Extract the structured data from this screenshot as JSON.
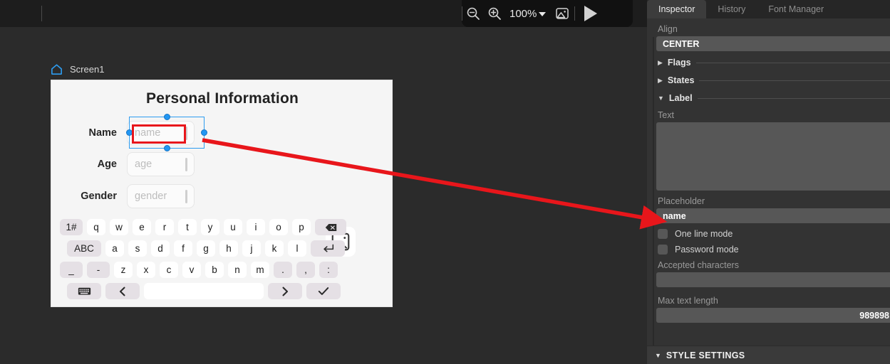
{
  "toolbar": {
    "zoom_out_icon": "zoom-out-icon",
    "zoom_in_icon": "zoom-in-icon",
    "zoom_level": "100%",
    "image_icon": "image-icon",
    "play_icon": "play-icon"
  },
  "canvas": {
    "screen_name": "Screen1",
    "home_icon": "home-icon",
    "form": {
      "title": "Personal Information",
      "fields": [
        {
          "label": "Name",
          "placeholder": "name",
          "selected": true
        },
        {
          "label": "Age",
          "placeholder": "age",
          "selected": false
        },
        {
          "label": "Gender",
          "placeholder": "gender",
          "selected": false
        }
      ],
      "image_placeholder_icon": "image-placeholder-icon"
    },
    "keyboard": {
      "row1": [
        "1#",
        "q",
        "w",
        "e",
        "r",
        "t",
        "y",
        "u",
        "i",
        "o",
        "p"
      ],
      "row1_action": "backspace",
      "row2": [
        "ABC",
        "a",
        "s",
        "d",
        "f",
        "g",
        "h",
        "j",
        "k",
        "l"
      ],
      "row2_action": "enter",
      "row3": [
        "_",
        "-",
        "z",
        "x",
        "c",
        "v",
        "b",
        "n",
        "m",
        ".",
        ",",
        ":"
      ],
      "row4": [
        "keyboard",
        "prev",
        "space",
        "next",
        "confirm"
      ]
    }
  },
  "inspector": {
    "tabs": [
      {
        "label": "Inspector",
        "active": true
      },
      {
        "label": "History",
        "active": false
      },
      {
        "label": "Font Manager",
        "active": false
      }
    ],
    "align": {
      "label": "Align",
      "value": "CENTER"
    },
    "sections": [
      {
        "label": "Flags",
        "expanded": false,
        "triangle": "▶"
      },
      {
        "label": "States",
        "expanded": false,
        "triangle": "▶"
      },
      {
        "label": "Label",
        "expanded": true,
        "triangle": "▼"
      }
    ],
    "text": {
      "label": "Text",
      "value": ""
    },
    "placeholder": {
      "label": "Placeholder",
      "value": "name"
    },
    "one_line_mode": {
      "label": "One line mode",
      "checked": false
    },
    "password_mode": {
      "label": "Password mode",
      "checked": false
    },
    "accepted_characters": {
      "label": "Accepted characters",
      "value": ""
    },
    "max_text_length": {
      "label": "Max text length",
      "value": "989898"
    },
    "style_settings": {
      "label": "STYLE SETTINGS",
      "triangle": "▼"
    }
  },
  "annotation": {
    "arrow_color": "#e8161b",
    "highlight_color": "#e8161b"
  }
}
